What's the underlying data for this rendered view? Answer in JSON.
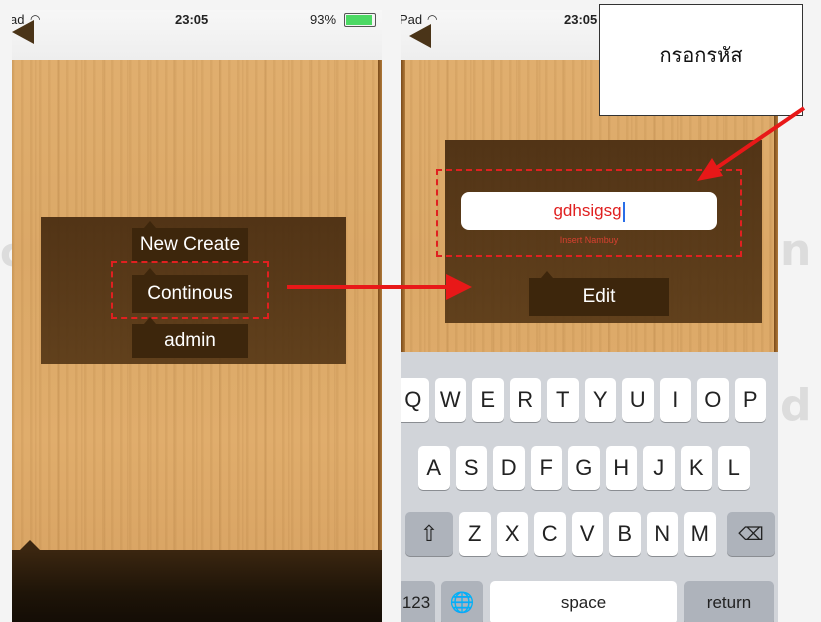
{
  "left_screen": {
    "status": {
      "carrier": "ad",
      "time": "23:05",
      "battery": "93%"
    },
    "menu": {
      "new_create": "New Create",
      "continous": "Continous",
      "admin": "admin"
    }
  },
  "right_screen": {
    "status": {
      "carrier": "Pad",
      "time": "23:05"
    },
    "input": {
      "value": "gdhsigsg",
      "hint": "Insert Nambuy"
    },
    "edit_label": "Edit",
    "keyboard": {
      "row1": [
        "Q",
        "W",
        "E",
        "R",
        "T",
        "Y",
        "U",
        "I",
        "O",
        "P"
      ],
      "row2": [
        "A",
        "S",
        "D",
        "F",
        "G",
        "H",
        "J",
        "K",
        "L"
      ],
      "row3": [
        "Z",
        "X",
        "C",
        "V",
        "B",
        "N",
        "M"
      ],
      "numbers_key": "123",
      "space_key": "space",
      "return_key": "return"
    }
  },
  "callout": {
    "text": "กรอกรหัส"
  },
  "colors": {
    "annotation_red": "#e81818",
    "wood": "#dba867",
    "panel_brown": "#3d260c"
  }
}
